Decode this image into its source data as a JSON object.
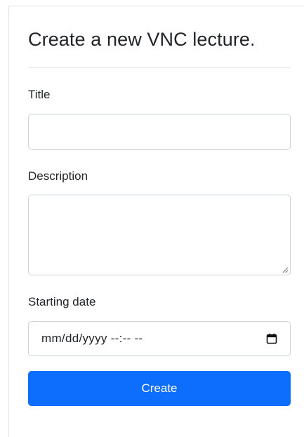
{
  "form": {
    "heading": "Create a new VNC lecture.",
    "title_label": "Title",
    "title_value": "",
    "description_label": "Description",
    "description_value": "",
    "date_label": "Starting date",
    "date_placeholder": "mm/dd/yyyy --:-- --",
    "date_icon": "calendar-icon",
    "submit_label": "Create"
  },
  "colors": {
    "primary": "#0d6efd",
    "border": "#ced4da",
    "text": "#212529"
  }
}
